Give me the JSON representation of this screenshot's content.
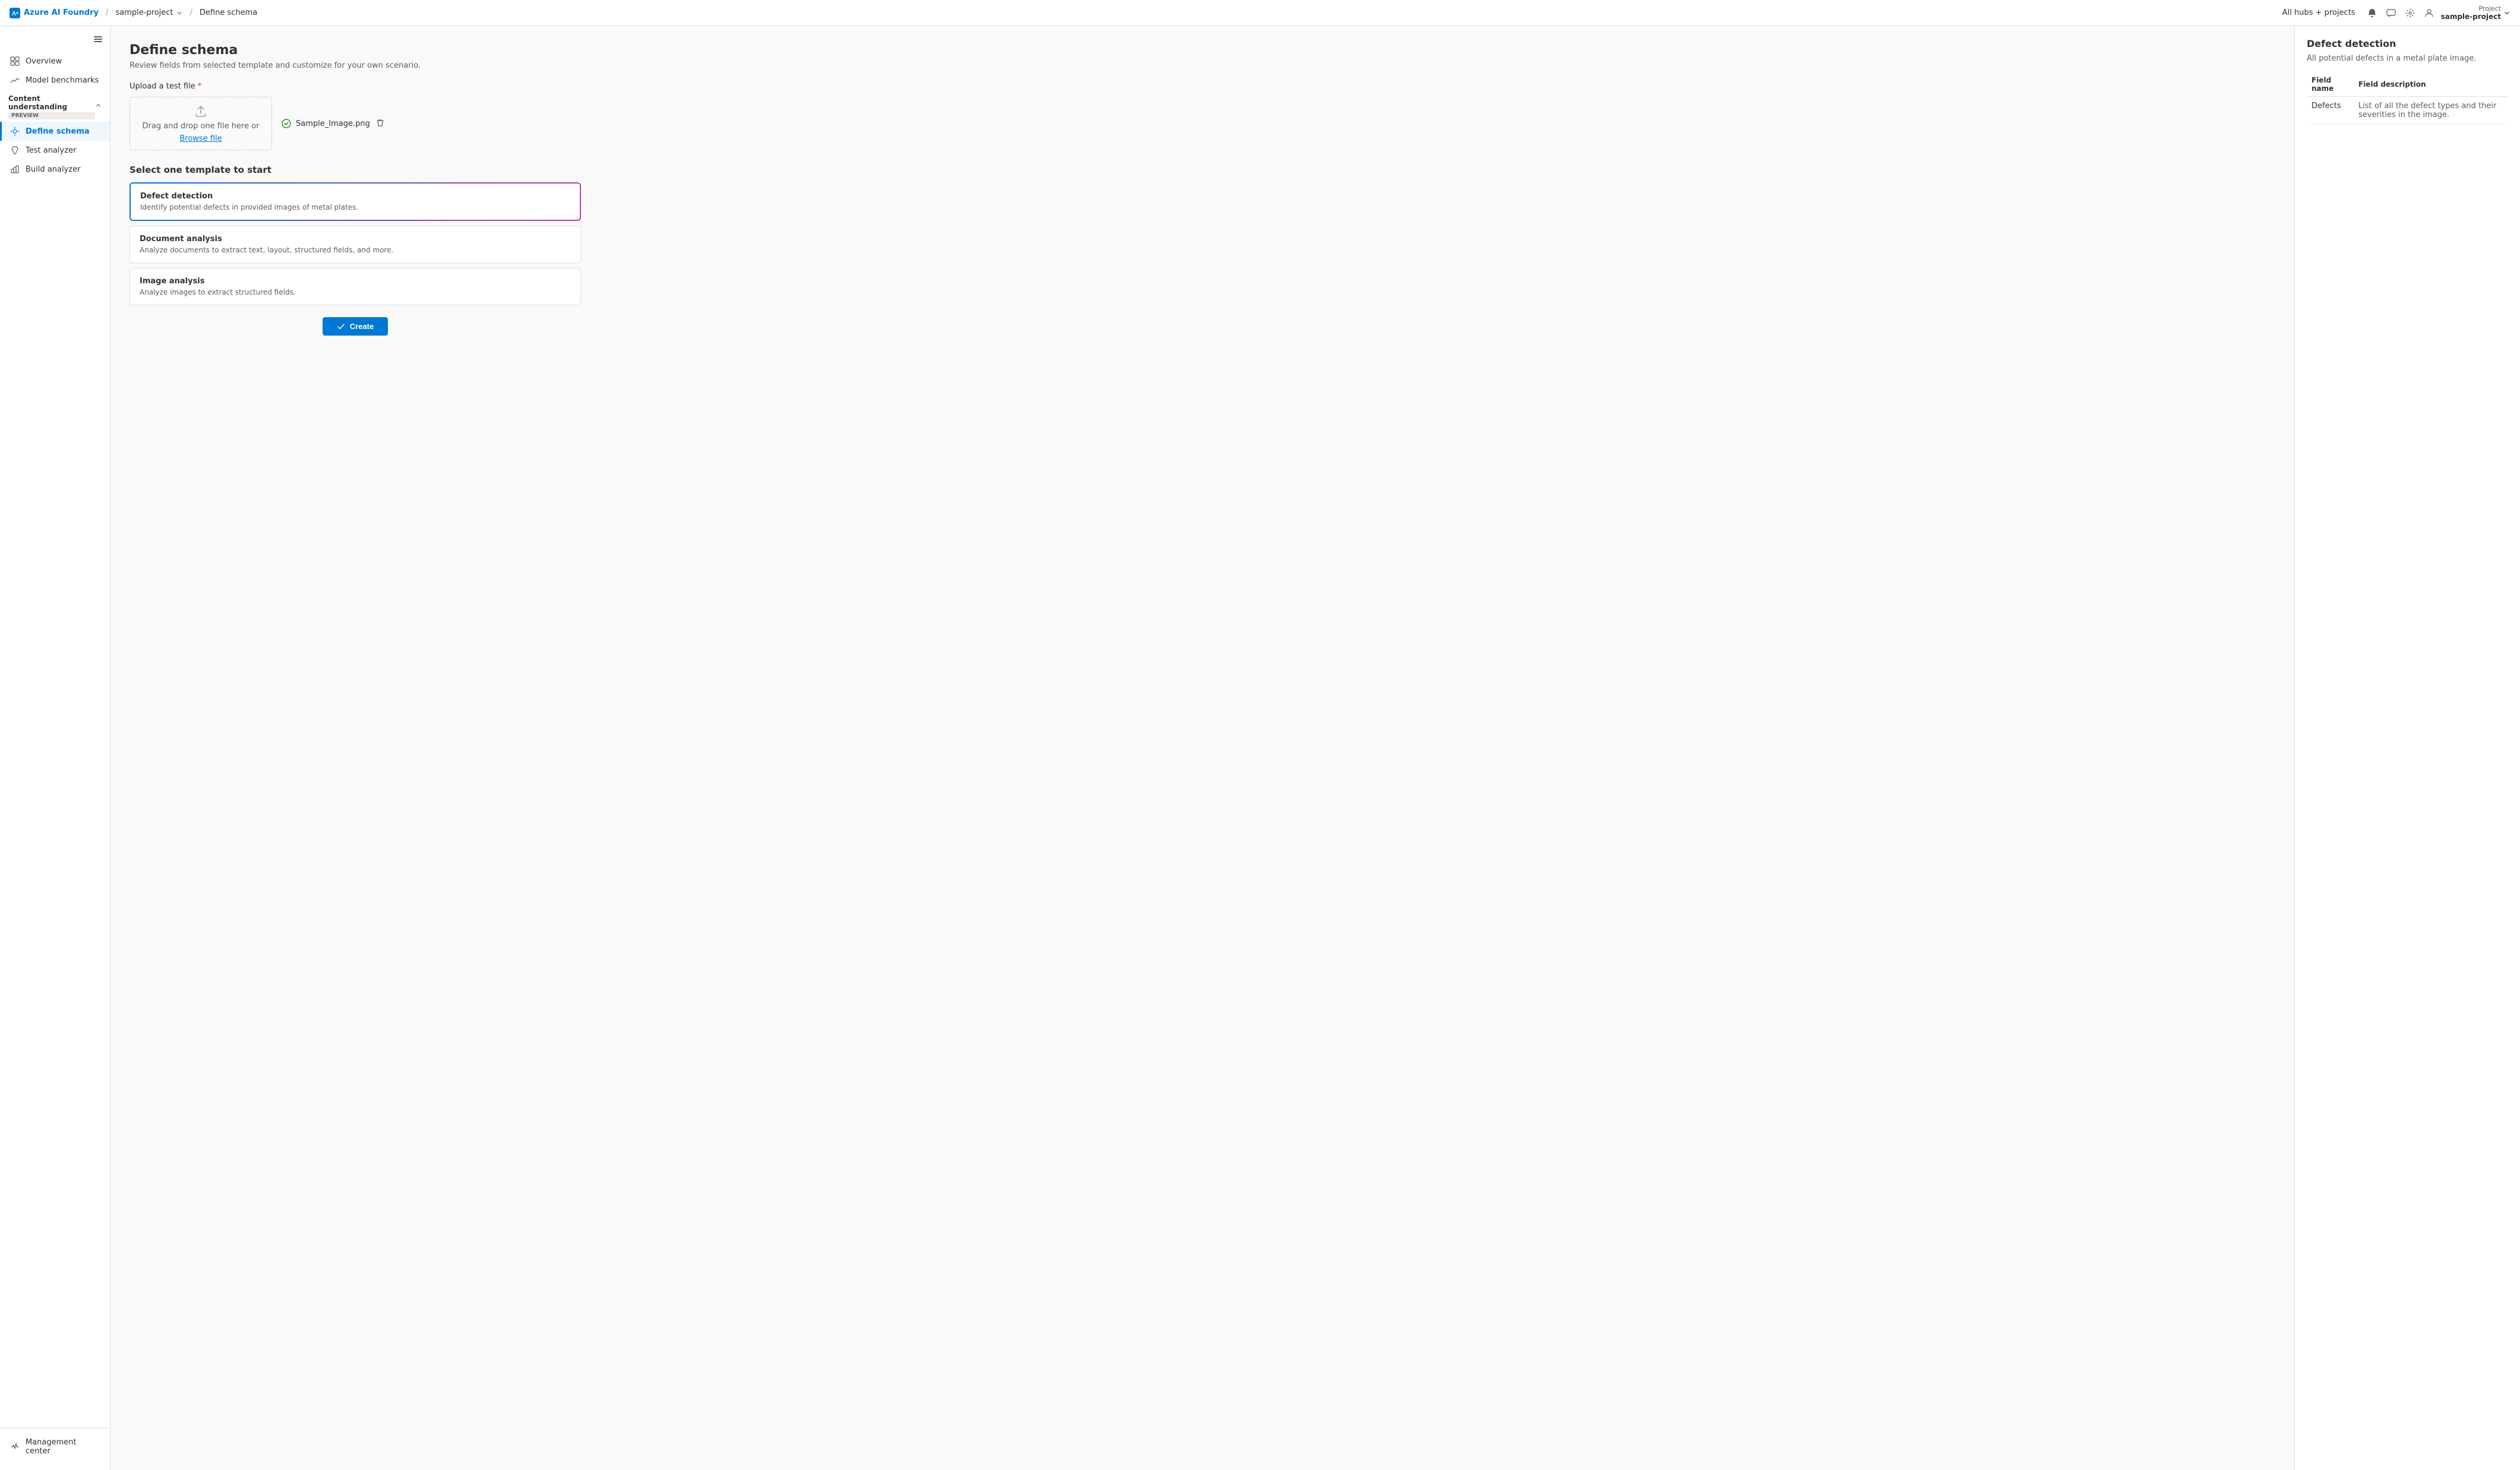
{
  "topbar": {
    "logo_text": "Azure AI Foundry",
    "project_name": "sample-project",
    "separator1": "/",
    "separator2": "/",
    "current_page": "Define schema",
    "all_hubs": "All hubs + projects",
    "project_label": "Project",
    "project_display": "sample-project"
  },
  "sidebar": {
    "toggle_label": "Toggle sidebar",
    "overview": "Overview",
    "model_benchmarks": "Model benchmarks",
    "content_understanding_label": "Content understanding",
    "preview_badge": "PREVIEW",
    "define_schema": "Define schema",
    "test_analyzer": "Test analyzer",
    "build_analyzer": "Build analyzer",
    "management_center": "Management center"
  },
  "page": {
    "title": "Define schema",
    "subtitle": "Review fields from selected template and customize for your own scenario.",
    "upload_label": "Upload a test file",
    "upload_hint1": "Drag and drop one file here or",
    "upload_hint2": "Browse file",
    "uploaded_file": "Sample_Image.png",
    "select_template_title": "Select one template to start",
    "templates": [
      {
        "id": "defect-detection",
        "title": "Defect detection",
        "description": "Identify potential defects in provided images of metal plates.",
        "selected": true
      },
      {
        "id": "document-analysis",
        "title": "Document analysis",
        "description": "Analyze documents to extract text, layout, structured fields, and more.",
        "selected": false
      },
      {
        "id": "image-analysis",
        "title": "Image analysis",
        "description": "Analyze images to extract structured fields.",
        "selected": false
      }
    ],
    "create_button": "Create"
  },
  "right_panel": {
    "title": "Defect detection",
    "description": "All potential defects in a metal plate image.",
    "table": {
      "col1": "Field name",
      "col2": "Field description",
      "rows": [
        {
          "field_name": "Defects",
          "field_description": "List of all the defect types and their severities in the image."
        }
      ]
    }
  }
}
